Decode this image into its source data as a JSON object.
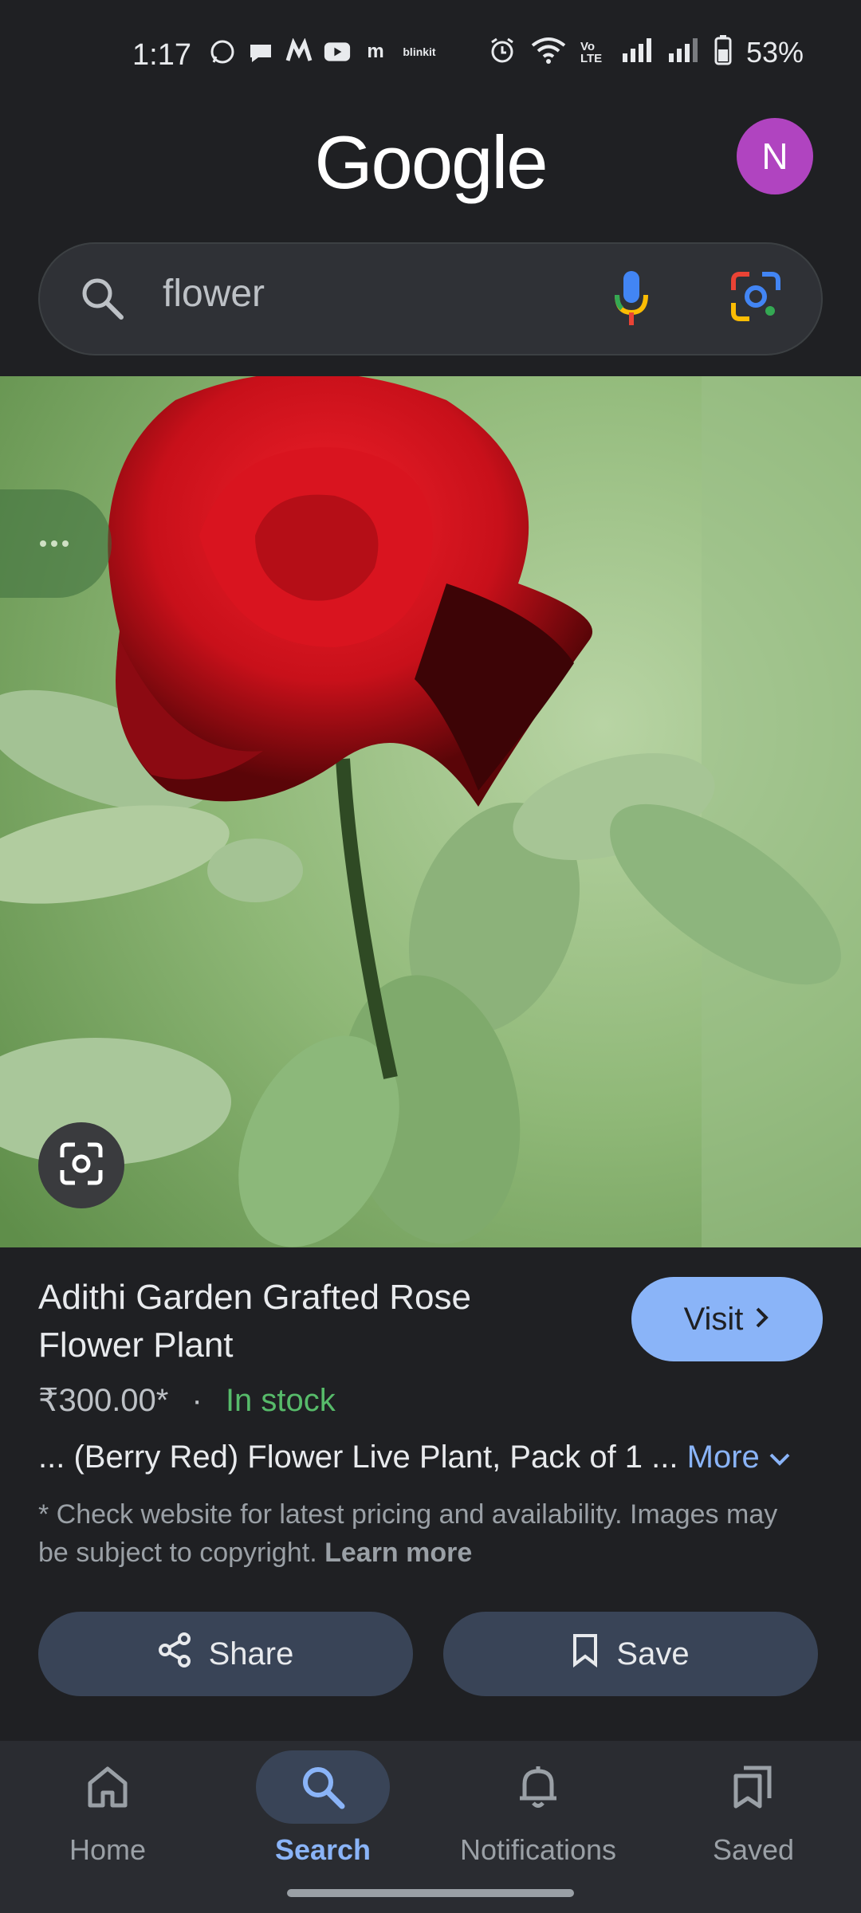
{
  "status_bar": {
    "time": "1:17",
    "app_icons": [
      "whatsapp-icon",
      "chat-bubble-icon",
      "m-logo-icon",
      "youtube-icon",
      "m-app-icon",
      "blinkit-icon"
    ],
    "blinkit_text": "blinkit",
    "m_letter": "m",
    "volte_text": "Vo LTE",
    "battery": "53%"
  },
  "header": {
    "logo": "Google",
    "avatar_letter": "N"
  },
  "search": {
    "query": "flower"
  },
  "product": {
    "title": "Adithi Garden Grafted Rose Flower Plant",
    "visit_label": "Visit",
    "price": "₹300.00*",
    "separator": "·",
    "stock": "In stock",
    "description": "... (Berry Red) Flower Live Plant, Pack of 1 ...",
    "more_label": "More",
    "disclaimer": "* Check website for latest pricing and availability. Images may be subject to copyright.",
    "learn_more": "Learn more"
  },
  "actions": {
    "share_label": "Share",
    "save_label": "Save"
  },
  "nav": {
    "items": [
      {
        "label": "Home",
        "icon": "home-icon"
      },
      {
        "label": "Search",
        "icon": "search-icon",
        "active": true
      },
      {
        "label": "Notifications",
        "icon": "bell-icon"
      },
      {
        "label": "Saved",
        "icon": "bookmarks-icon"
      }
    ]
  },
  "colors": {
    "background": "#1f2023",
    "accent": "#8ab4f8",
    "in_stock": "#57bb6a",
    "avatar": "#b044c0"
  }
}
